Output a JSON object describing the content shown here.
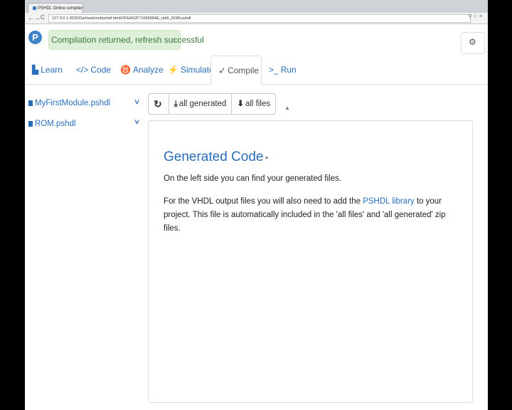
{
  "browser": {
    "tab_title": "PSHDL Online compiler",
    "url": "127.0.0.1:3030/Dart/web/out/pshdl.html#2FEA62F7165989AE_tab5_ROM.pshdl",
    "nav": {
      "back": "←",
      "forward": "→",
      "reload": "C"
    }
  },
  "header": {
    "logo_letter": "P",
    "alert_text": "Compilation returned, refresh successful",
    "alert_close": "×",
    "corner_icon": "⚙"
  },
  "tabs": [
    {
      "label": "Learn",
      "icon": "book-icon",
      "glyph": "▙"
    },
    {
      "label": "Code",
      "icon": "code-icon",
      "glyph": "</>"
    },
    {
      "label": "Analyze",
      "icon": "stethoscope-icon",
      "glyph": "♉"
    },
    {
      "label": "Simulate",
      "icon": "bolt-icon",
      "glyph": "⚡"
    },
    {
      "label": "Compile",
      "icon": "rocket-icon",
      "glyph": "➶"
    },
    {
      "label": "Run",
      "icon": "terminal-icon",
      "glyph": ">_"
    }
  ],
  "sidebar": {
    "files": [
      {
        "name": "MyFirstModule.pshdl"
      },
      {
        "name": "ROM.pshdl"
      }
    ],
    "chevron": "∨"
  },
  "toolbar": {
    "refresh_glyph": "↻",
    "all_generated_glyph": "⤓",
    "all_generated_label": "all generated",
    "all_files_glyph": "⬇",
    "all_files_label": "all files"
  },
  "content": {
    "heading": "Generated Code",
    "para1": "On the left side you can find your generated files.",
    "para2_before": "For the VHDL output files you will also need to add the ",
    "para2_link": "PSHDL library",
    "para2_after": " to your project. This file is automatically included in the 'all files' and 'all generated' zip files."
  },
  "colors": {
    "accent": "#2a6ebb",
    "alert_bg": "#dff0d8",
    "alert_text": "#3c763d",
    "logo": "#3f83c8"
  }
}
